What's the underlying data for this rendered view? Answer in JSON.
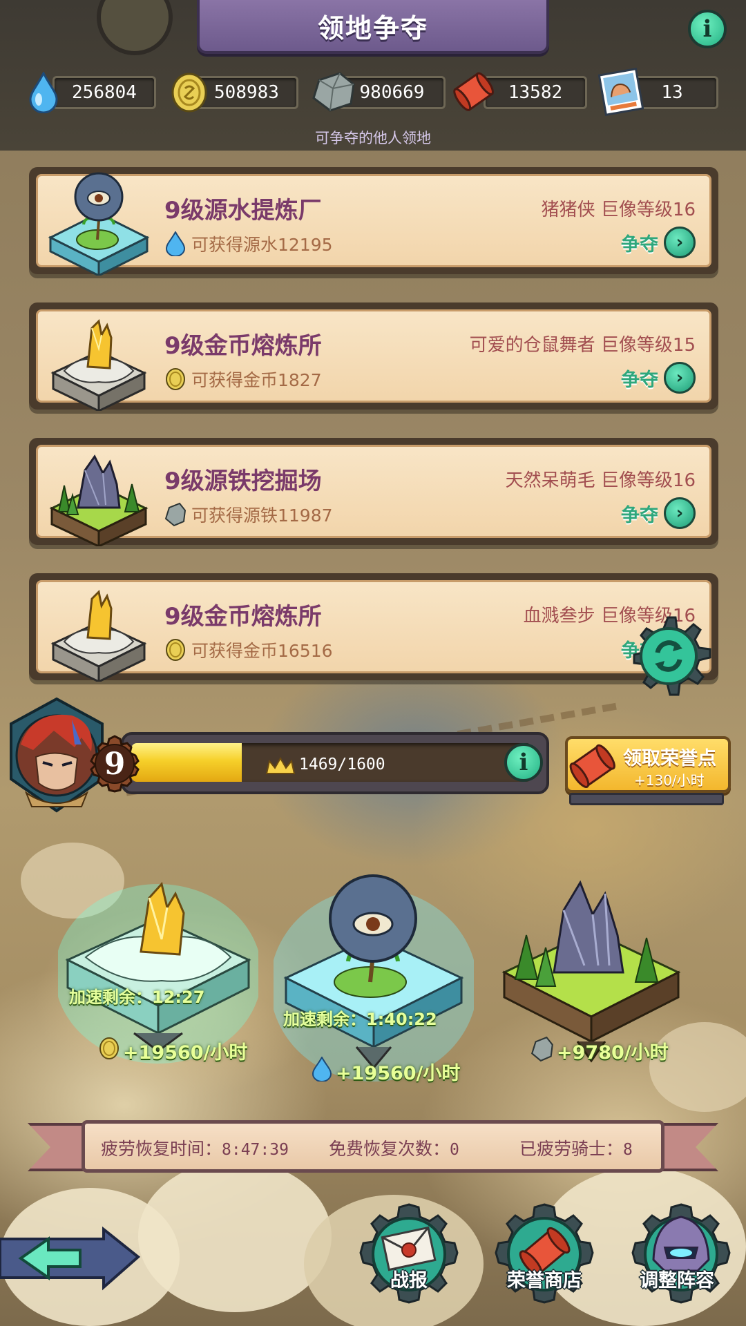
{
  "header": {
    "title": "领地争夺",
    "subtitle": "可争夺的他人领地"
  },
  "resources": [
    {
      "name": "source-water",
      "icon": "water-drop-icon",
      "value": "256804"
    },
    {
      "name": "gold-coin",
      "icon": "gold-coin-icon",
      "value": "508983"
    },
    {
      "name": "source-iron",
      "icon": "iron-ore-icon",
      "value": "980669"
    },
    {
      "name": "honor-scroll",
      "icon": "scroll-icon",
      "value": "13582"
    },
    {
      "name": "stamina-card",
      "icon": "muscle-card-icon",
      "value": "13"
    }
  ],
  "cards": [
    {
      "title": "9级源水提炼厂",
      "gain": "可获得源水12195",
      "owner": "猪猪侠  巨像等级16",
      "button": "争夺",
      "gain_icon": "water-drop-icon",
      "building_icon": "water-refinery-icon"
    },
    {
      "title": "9级金币熔炼所",
      "gain": "可获得金币1827",
      "owner": "可爱的仓鼠舞者  巨像等级15",
      "button": "争夺",
      "gain_icon": "gold-coin-icon",
      "building_icon": "gold-smelter-icon"
    },
    {
      "title": "9级源铁挖掘场",
      "gain": "可获得源铁11987",
      "owner": "天然呆萌毛  巨像等级16",
      "button": "争夺",
      "gain_icon": "iron-ore-icon",
      "building_icon": "iron-mine-icon"
    },
    {
      "title": "9级金币熔炼所",
      "gain": "可获得金币16516",
      "owner": "血溅叁步  巨像等级16",
      "button": "争夺",
      "gain_icon": "gold-coin-icon",
      "building_icon": "gold-smelter-icon"
    }
  ],
  "level": {
    "number": "9",
    "progress_text": "1469/1600",
    "progress": 0.918
  },
  "claim": {
    "label": "领取荣誉点",
    "rate": "+130/小时"
  },
  "islands": [
    {
      "speed": "加速剩余：12:27",
      "rate": "+19560/小时",
      "icon": "gold-coin-icon"
    },
    {
      "speed": "加速剩余：1:40:22",
      "rate": "+19560/小时",
      "icon": "water-drop-icon"
    },
    {
      "speed": "",
      "rate": "+9780/小时",
      "icon": "iron-ore-icon"
    }
  ],
  "fatigue": {
    "recover_label": "疲劳恢复时间：",
    "recover_value": "8:47:39",
    "free_label": "免费恢复次数：",
    "free_value": "0",
    "tired_label": "已疲劳骑士：",
    "tired_value": "8"
  },
  "bottom_nav": [
    {
      "label": "战报",
      "icon": "envelope-icon"
    },
    {
      "label": "荣誉商店",
      "icon": "scroll-icon"
    },
    {
      "label": "调整阵容",
      "icon": "helmet-icon"
    }
  ],
  "colors": {
    "accent_green": "#2ea77c",
    "card_bg": "#f8e5c6",
    "title_purple": "#7a3a6a",
    "gold": "#f6d02a"
  }
}
